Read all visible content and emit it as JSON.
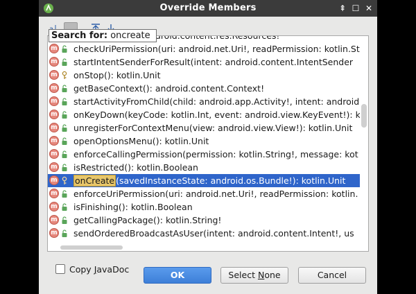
{
  "dialog": {
    "title": "Override Members",
    "controls": {
      "pin": "⇞",
      "maximize": "☐",
      "close": "✕"
    }
  },
  "toolbar": {
    "sort_alpha_icon": "sort-alphabetically-icon",
    "group_icon": "group-by-class-icon",
    "expand_icon": "expand-all-icon",
    "collapse_icon": "collapse-all-icon"
  },
  "search": {
    "label": "Search for:",
    "value": "oncreate"
  },
  "members": [
    {
      "text": "getResources(): android.content.res.Resources!",
      "access": "public"
    },
    {
      "text": "checkUriPermission(uri: android.net.Uri!, readPermission: kotlin.St",
      "access": "public"
    },
    {
      "text": "startIntentSenderForResult(intent: android.content.IntentSender",
      "access": "public"
    },
    {
      "text": "onStop(): kotlin.Unit",
      "access": "protected"
    },
    {
      "text": "getBaseContext(): android.content.Context!",
      "access": "public"
    },
    {
      "text": "startActivityFromChild(child: android.app.Activity!, intent: android.",
      "access": "public"
    },
    {
      "text": "onKeyDown(keyCode: kotlin.Int, event: android.view.KeyEvent!): ko",
      "access": "public"
    },
    {
      "text": "unregisterForContextMenu(view: android.view.View!): kotlin.Unit",
      "access": "public"
    },
    {
      "text": "openOptionsMenu(): kotlin.Unit",
      "access": "public"
    },
    {
      "text": "enforceCallingPermission(permission: kotlin.String!, message: kot",
      "access": "public"
    },
    {
      "text": "isRestricted(): kotlin.Boolean",
      "access": "public"
    },
    {
      "text": "(savedInstanceState: android.os.Bundle!): kotlin.Unit",
      "match": "onCreate",
      "access": "protected",
      "selected": true
    },
    {
      "text": "enforceUriPermission(uri: android.net.Uri!, readPermission: kotlin.",
      "access": "public"
    },
    {
      "text": "isFinishing(): kotlin.Boolean",
      "access": "public"
    },
    {
      "text": "getCallingPackage(): kotlin.String!",
      "access": "public"
    },
    {
      "text": "sendOrderedBroadcastAsUser(intent: android.content.Intent!, us",
      "access": "public"
    }
  ],
  "member_badge": "m",
  "copy_javadoc": {
    "pre": "Copy ",
    "mnemonic": "J",
    "post": "avaDoc",
    "checked": false
  },
  "buttons": {
    "ok": "OK",
    "select_none_pre": "Select ",
    "select_none_mnemonic": "N",
    "select_none_post": "one",
    "cancel": "Cancel"
  },
  "colors": {
    "selection": "#2f65ca",
    "match_highlight": "#e7c66a",
    "member_badge": "#e5877c",
    "primary_button": "#3d7fd8"
  }
}
